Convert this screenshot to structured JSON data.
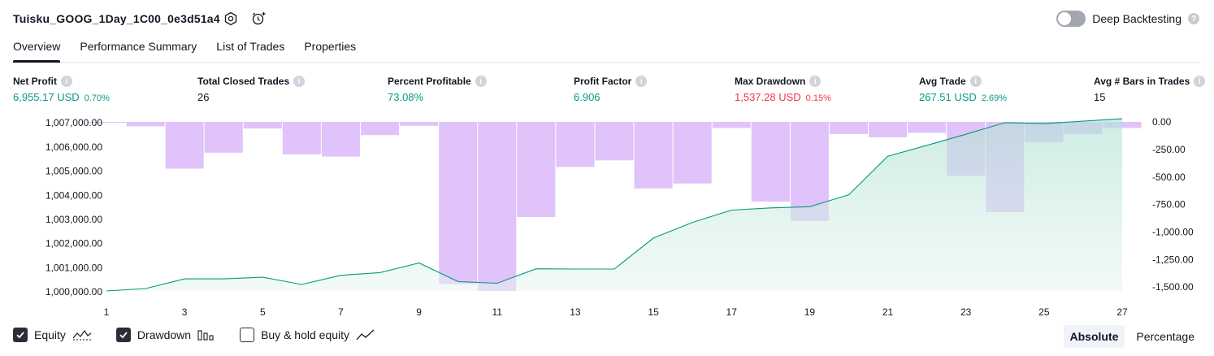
{
  "header": {
    "title": "Tuisku_GOOG_1Day_1C00_0e3d51a4",
    "deep_backtesting_label": "Deep Backtesting",
    "deep_backtesting_on": false
  },
  "tabs": [
    {
      "label": "Overview",
      "active": true
    },
    {
      "label": "Performance Summary",
      "active": false
    },
    {
      "label": "List of Trades",
      "active": false
    },
    {
      "label": "Properties",
      "active": false
    }
  ],
  "metrics": [
    {
      "label": "Net Profit",
      "value": "6,955.17 USD",
      "pct": "0.70%",
      "color": "#089981"
    },
    {
      "label": "Total Closed Trades",
      "value": "26",
      "pct": "",
      "color": "#131722"
    },
    {
      "label": "Percent Profitable",
      "value": "73.08%",
      "pct": "",
      "color": "#089981"
    },
    {
      "label": "Profit Factor",
      "value": "6.906",
      "pct": "",
      "color": "#089981"
    },
    {
      "label": "Max Drawdown",
      "value": "1,537.28 USD",
      "pct": "0.15%",
      "color": "#f23645"
    },
    {
      "label": "Avg Trade",
      "value": "267.51 USD",
      "pct": "2.69%",
      "color": "#089981"
    },
    {
      "label": "Avg # Bars in Trades",
      "value": "15",
      "pct": "",
      "color": "#131722"
    }
  ],
  "chart_data": {
    "type": "area",
    "x": [
      1,
      2,
      3,
      4,
      5,
      6,
      7,
      8,
      9,
      10,
      11,
      12,
      13,
      14,
      15,
      16,
      17,
      18,
      19,
      20,
      21,
      22,
      23,
      24,
      25,
      26,
      27
    ],
    "x_tick_labels": [
      "1",
      "3",
      "5",
      "7",
      "9",
      "11",
      "13",
      "15",
      "17",
      "19",
      "21",
      "23",
      "25",
      "27"
    ],
    "left_axis": {
      "ylim": [
        1000000,
        1007000
      ],
      "tick_labels": [
        "1,007,000.00",
        "1,006,000.00",
        "1,005,000.00",
        "1,004,000.00",
        "1,003,000.00",
        "1,002,000.00",
        "1,001,000.00",
        "1,000,000.00"
      ]
    },
    "right_axis": {
      "ylim": [
        -1537.28,
        0
      ],
      "tick_labels": [
        "0.00",
        "-250.00",
        "-500.00",
        "-750.00",
        "-1,000.00",
        "-1,250.00",
        "-1,500.00"
      ]
    },
    "series": [
      {
        "name": "Equity",
        "axis": "left",
        "values": [
          1000000,
          1000100,
          1000500,
          1000500,
          1000570,
          1000270,
          1000650,
          1000760,
          1001160,
          1000390,
          1000320,
          1000920,
          1000910,
          1000910,
          1002190,
          1002840,
          1003350,
          1003440,
          1003490,
          1003980,
          1005580,
          1006030,
          1006490,
          1006970,
          1006930,
          1007030,
          1007130
        ],
        "color": "#089981",
        "fill": "#c9ebe2"
      },
      {
        "name": "Drawdown",
        "axis": "right",
        "bars": [
          {
            "x": 1,
            "value": -5
          },
          {
            "x": 2,
            "value": -40
          },
          {
            "x": 3,
            "value": -425
          },
          {
            "x": 4,
            "value": -280
          },
          {
            "x": 5,
            "value": -60
          },
          {
            "x": 6,
            "value": -295
          },
          {
            "x": 7,
            "value": -315
          },
          {
            "x": 8,
            "value": -120
          },
          {
            "x": 9,
            "value": -35
          },
          {
            "x": 10,
            "value": -1475
          },
          {
            "x": 11,
            "value": -1537.28
          },
          {
            "x": 12,
            "value": -865
          },
          {
            "x": 13,
            "value": -410
          },
          {
            "x": 14,
            "value": -350
          },
          {
            "x": 15,
            "value": -605
          },
          {
            "x": 16,
            "value": -560
          },
          {
            "x": 17,
            "value": -55
          },
          {
            "x": 18,
            "value": -725
          },
          {
            "x": 19,
            "value": -900
          },
          {
            "x": 20,
            "value": -110
          },
          {
            "x": 21,
            "value": -140
          },
          {
            "x": 22,
            "value": -100
          },
          {
            "x": 23,
            "value": -490
          },
          {
            "x": 24,
            "value": -820
          },
          {
            "x": 25,
            "value": -185
          },
          {
            "x": 26,
            "value": -110
          },
          {
            "x": 27,
            "value": -55
          }
        ],
        "color": "#e1c3fb"
      },
      {
        "name": "Buy & hold equity",
        "visible": false
      }
    ]
  },
  "legend": {
    "equity_label": "Equity",
    "equity_checked": true,
    "drawdown_label": "Drawdown",
    "drawdown_checked": true,
    "bh_label": "Buy & hold equity",
    "bh_checked": false
  },
  "mode_toggle": {
    "absolute": "Absolute",
    "percentage": "Percentage",
    "selected": "Absolute"
  },
  "icons": [
    "settings-icon",
    "alert-add-icon",
    "help-icon",
    "info-icon",
    "check-icon",
    "equity-line-icon",
    "drawdown-bars-icon",
    "bh-line-icon"
  ]
}
